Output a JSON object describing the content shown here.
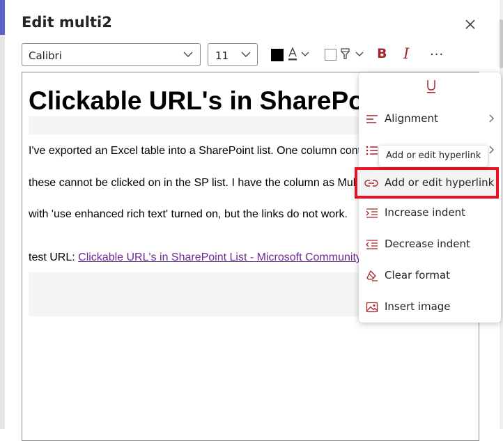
{
  "dialog": {
    "title": "Edit multi2"
  },
  "toolbar": {
    "font_family": "Calibri",
    "font_size": "11",
    "font_color": "#000000",
    "bold_label": "B",
    "italic_label": "I",
    "more_label": "···",
    "accent_color": "#a4262c"
  },
  "editor": {
    "heading": "Clickable URL's in SharePoint List",
    "paragraphs": [
      "I've exported an Excel table into a SharePoint list. One column contains hyperlinks, however",
      "these cannot be clicked on in the SP list. I have the column as Multiple lines of text,",
      "with 'use enhanced rich text' turned on, but the links do not work."
    ],
    "test_label": "test URL: ",
    "test_link": "Clickable URL's in SharePoint List - Microsoft Community"
  },
  "format_menu": {
    "items": [
      {
        "label": "Alignment",
        "icon": "align-left-icon",
        "has_submenu": true
      },
      {
        "label": "Bullets",
        "icon": "bullet-list-icon",
        "has_submenu": true
      },
      {
        "label": "Add or edit hyperlink",
        "icon": "link-icon",
        "has_submenu": false
      },
      {
        "label": "Increase indent",
        "icon": "increase-indent-icon",
        "has_submenu": false
      },
      {
        "label": "Decrease indent",
        "icon": "decrease-indent-icon",
        "has_submenu": false
      },
      {
        "label": "Clear format",
        "icon": "clear-format-icon",
        "has_submenu": false
      },
      {
        "label": "Insert image",
        "icon": "image-icon",
        "has_submenu": false
      }
    ],
    "tooltip": "Add or edit hyperlink",
    "highlight_color": "#e81123"
  }
}
